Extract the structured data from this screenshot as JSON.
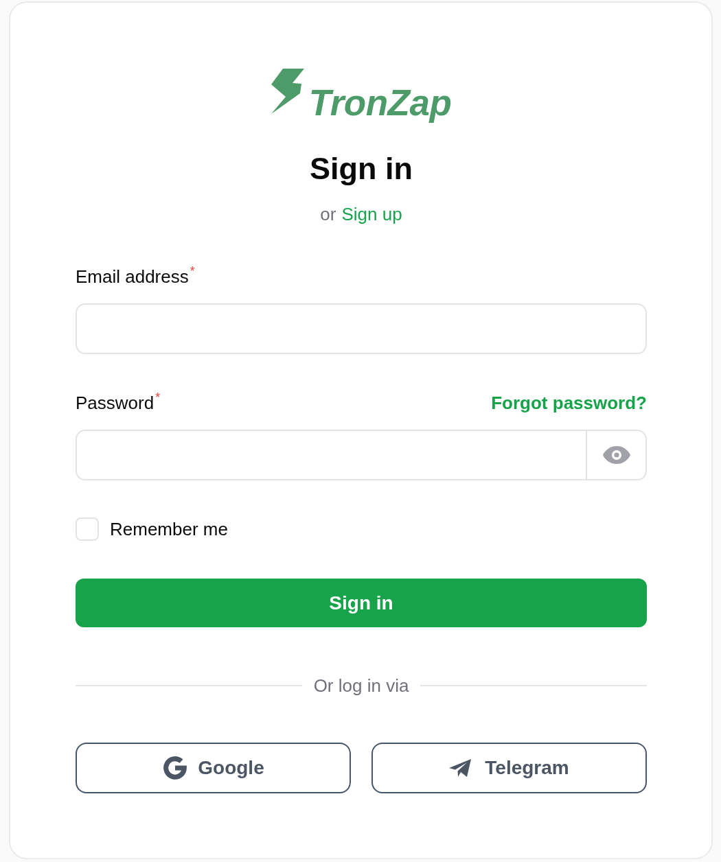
{
  "logo": {
    "text": "TronZap"
  },
  "heading": "Sign in",
  "signup_prompt": {
    "text": "or",
    "link": "Sign up"
  },
  "fields": [
    {
      "kind": "email",
      "label": "Email address",
      "required_mark": "*"
    },
    {
      "kind": "password",
      "label": "Password",
      "required_mark": "*",
      "link": "Forgot password?"
    }
  ],
  "remember": {
    "label": "Remember me",
    "checked": false
  },
  "submit": {
    "label": "Sign in"
  },
  "divider": {
    "text": "Or log in via"
  },
  "social_buttons": [
    {
      "kind": "google",
      "label": "Google"
    },
    {
      "kind": "telegram",
      "label": "Telegram"
    }
  ]
}
